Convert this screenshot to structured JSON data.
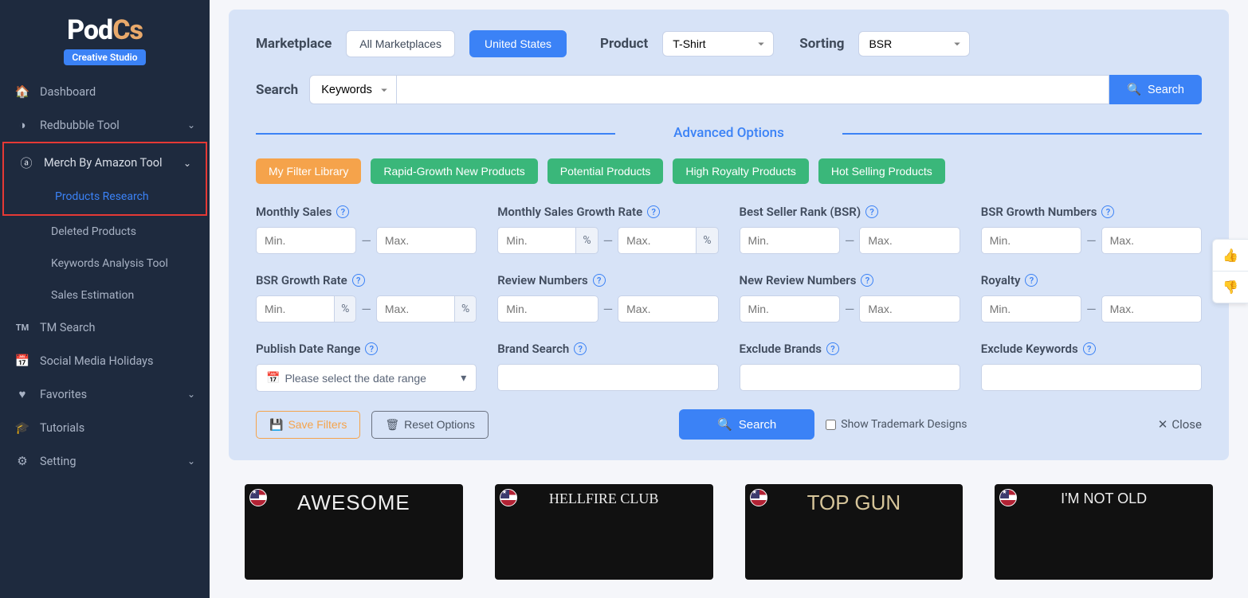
{
  "logo": {
    "part1": "Pod",
    "part2": "Cs",
    "sub": "Creative Studio"
  },
  "sidebar": {
    "dashboard": "Dashboard",
    "redbubble": "Redbubble Tool",
    "merch": "Merch By Amazon Tool",
    "merch_sub": {
      "products_research": "Products Research",
      "deleted_products": "Deleted Products",
      "keywords_analysis": "Keywords Analysis Tool",
      "sales_estimation": "Sales Estimation"
    },
    "tm_search": "TM Search",
    "tm_badge": "TM",
    "holidays": "Social Media Holidays",
    "favorites": "Favorites",
    "tutorials": "Tutorials",
    "setting": "Setting"
  },
  "top": {
    "marketplace_label": "Marketplace",
    "all_marketplaces": "All Marketplaces",
    "united_states": "United States",
    "product_label": "Product",
    "product_value": "T-Shirt",
    "sorting_label": "Sorting",
    "sorting_value": "BSR"
  },
  "search": {
    "label": "Search",
    "type": "Keywords",
    "button": "Search"
  },
  "adv_title": "Advanced Options",
  "filter_buttons": {
    "library": "My Filter Library",
    "rapid": "Rapid-Growth New Products",
    "potential": "Potential Products",
    "royalty": "High Royalty Products",
    "hot": "Hot Selling Products"
  },
  "fields": {
    "monthly_sales": "Monthly Sales",
    "monthly_sales_growth": "Monthly Sales Growth Rate",
    "bsr": "Best Seller Rank (BSR)",
    "bsr_growth_numbers": "BSR Growth Numbers",
    "bsr_growth_rate": "BSR Growth Rate",
    "review_numbers": "Review Numbers",
    "new_review_numbers": "New Review Numbers",
    "royalty": "Royalty",
    "publish_date": "Publish Date Range",
    "brand_search": "Brand Search",
    "exclude_brands": "Exclude Brands",
    "exclude_keywords": "Exclude Keywords",
    "min": "Min.",
    "max": "Max.",
    "pct": "%",
    "date_placeholder": "Please select the date range"
  },
  "actions": {
    "save_filters": "Save Filters",
    "reset_options": "Reset Options",
    "search": "Search",
    "show_tm": "Show Trademark Designs",
    "close": "Close"
  },
  "cards": {
    "c1": "AWESOME",
    "c2": "HELLFIRE CLUB",
    "c3": "TOP GUN",
    "c4": "I'M NOT OLD"
  }
}
